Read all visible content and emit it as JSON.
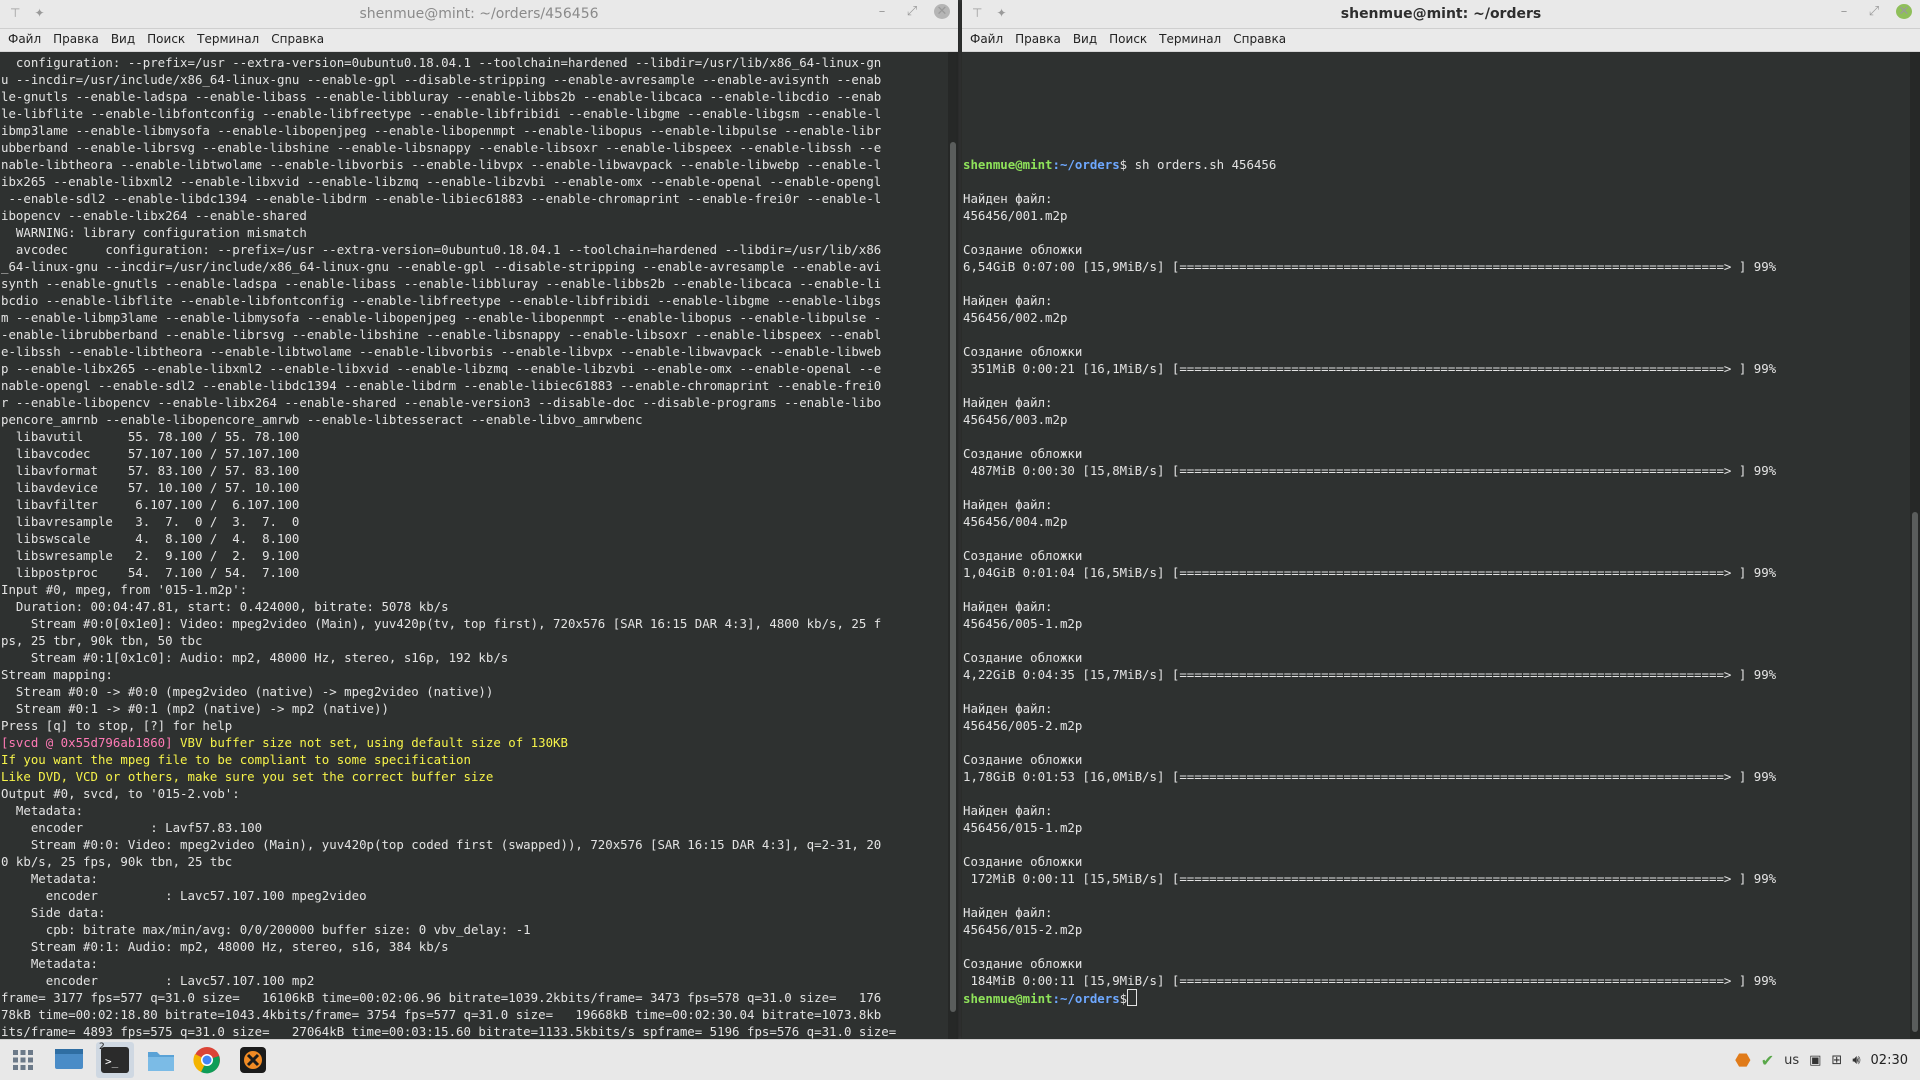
{
  "colors": {
    "accent_green": "#8fe35a",
    "path_blue": "#6ea8ff",
    "warning_yellow": "#f6f34a"
  },
  "left": {
    "title": "shenmue@mint: ~/orders/456456",
    "menu": [
      "Файл",
      "Правка",
      "Вид",
      "Поиск",
      "Терминал",
      "Справка"
    ],
    "lines": [
      {
        "t": "  configuration: --prefix=/usr --extra-version=0ubuntu0.18.04.1 --toolchain=hardened --libdir=/usr/lib/x86_64-linux-gn"
      },
      {
        "t": "u --incdir=/usr/include/x86_64-linux-gnu --enable-gpl --disable-stripping --enable-avresample --enable-avisynth --enab"
      },
      {
        "t": "le-gnutls --enable-ladspa --enable-libass --enable-libbluray --enable-libbs2b --enable-libcaca --enable-libcdio --enab"
      },
      {
        "t": "le-libflite --enable-libfontconfig --enable-libfreetype --enable-libfribidi --enable-libgme --enable-libgsm --enable-l"
      },
      {
        "t": "ibmp3lame --enable-libmysofa --enable-libopenjpeg --enable-libopenmpt --enable-libopus --enable-libpulse --enable-libr"
      },
      {
        "t": "ubberband --enable-librsvg --enable-libshine --enable-libsnappy --enable-libsoxr --enable-libspeex --enable-libssh --e"
      },
      {
        "t": "nable-libtheora --enable-libtwolame --enable-libvorbis --enable-libvpx --enable-libwavpack --enable-libwebp --enable-l"
      },
      {
        "t": "ibx265 --enable-libxml2 --enable-libxvid --enable-libzmq --enable-libzvbi --enable-omx --enable-openal --enable-opengl"
      },
      {
        "t": " --enable-sdl2 --enable-libdc1394 --enable-libdrm --enable-libiec61883 --enable-chromaprint --enable-frei0r --enable-l"
      },
      {
        "t": "ibopencv --enable-libx264 --enable-shared"
      },
      {
        "t": "  WARNING: library configuration mismatch"
      },
      {
        "t": "  avcodec     configuration: --prefix=/usr --extra-version=0ubuntu0.18.04.1 --toolchain=hardened --libdir=/usr/lib/x86"
      },
      {
        "t": "_64-linux-gnu --incdir=/usr/include/x86_64-linux-gnu --enable-gpl --disable-stripping --enable-avresample --enable-avi"
      },
      {
        "t": "synth --enable-gnutls --enable-ladspa --enable-libass --enable-libbluray --enable-libbs2b --enable-libcaca --enable-li"
      },
      {
        "t": "bcdio --enable-libflite --enable-libfontconfig --enable-libfreetype --enable-libfribidi --enable-libgme --enable-libgs"
      },
      {
        "t": "m --enable-libmp3lame --enable-libmysofa --enable-libopenjpeg --enable-libopenmpt --enable-libopus --enable-libpulse -"
      },
      {
        "t": "-enable-librubberband --enable-librsvg --enable-libshine --enable-libsnappy --enable-libsoxr --enable-libspeex --enabl"
      },
      {
        "t": "e-libssh --enable-libtheora --enable-libtwolame --enable-libvorbis --enable-libvpx --enable-libwavpack --enable-libweb"
      },
      {
        "t": "p --enable-libx265 --enable-libxml2 --enable-libxvid --enable-libzmq --enable-libzvbi --enable-omx --enable-openal --e"
      },
      {
        "t": "nable-opengl --enable-sdl2 --enable-libdc1394 --enable-libdrm --enable-libiec61883 --enable-chromaprint --enable-frei0"
      },
      {
        "t": "r --enable-libopencv --enable-libx264 --enable-shared --enable-version3 --disable-doc --disable-programs --enable-libo"
      },
      {
        "t": "pencore_amrnb --enable-libopencore_amrwb --enable-libtesseract --enable-libvo_amrwbenc"
      },
      {
        "t": "  libavutil      55. 78.100 / 55. 78.100"
      },
      {
        "t": "  libavcodec     57.107.100 / 57.107.100"
      },
      {
        "t": "  libavformat    57. 83.100 / 57. 83.100"
      },
      {
        "t": "  libavdevice    57. 10.100 / 57. 10.100"
      },
      {
        "t": "  libavfilter     6.107.100 /  6.107.100"
      },
      {
        "t": "  libavresample   3.  7.  0 /  3.  7.  0"
      },
      {
        "t": "  libswscale      4.  8.100 /  4.  8.100"
      },
      {
        "t": "  libswresample   2.  9.100 /  2.  9.100"
      },
      {
        "t": "  libpostproc    54.  7.100 / 54.  7.100"
      },
      {
        "t": "Input #0, mpeg, from '015-1.m2p':"
      },
      {
        "t": "  Duration: 00:04:47.81, start: 0.424000, bitrate: 5078 kb/s"
      },
      {
        "t": "    Stream #0:0[0x1e0]: Video: mpeg2video (Main), yuv420p(tv, top first), 720x576 [SAR 16:15 DAR 4:3], 4800 kb/s, 25 f"
      },
      {
        "t": "ps, 25 tbr, 90k tbn, 50 tbc"
      },
      {
        "t": "    Stream #0:1[0x1c0]: Audio: mp2, 48000 Hz, stereo, s16p, 192 kb/s"
      },
      {
        "t": "Stream mapping:"
      },
      {
        "t": "  Stream #0:0 -> #0:0 (mpeg2video (native) -> mpeg2video (native))"
      },
      {
        "t": "  Stream #0:1 -> #0:1 (mp2 (native) -> mp2 (native))"
      },
      {
        "t": "Press [q] to stop, [?] for help"
      },
      {
        "t": "[svcd @ 0x55d796ab1860] ",
        "cls": "pinkbg",
        "t2": "VBV buffer size not set, using default size of 130KB"
      },
      {
        "t": "If you want the mpeg file to be compliant to some specification",
        "cls": "yellow"
      },
      {
        "t": "Like DVD, VCD or others, make sure you set the correct buffer size",
        "cls": "yellow"
      },
      {
        "t": "Output #0, svcd, to '015-2.vob':"
      },
      {
        "t": "  Metadata:"
      },
      {
        "t": "    encoder         : Lavf57.83.100"
      },
      {
        "t": "    Stream #0:0: Video: mpeg2video (Main), yuv420p(top coded first (swapped)), 720x576 [SAR 16:15 DAR 4:3], q=2-31, 20"
      },
      {
        "t": "0 kb/s, 25 fps, 90k tbn, 25 tbc"
      },
      {
        "t": "    Metadata:"
      },
      {
        "t": "      encoder         : Lavc57.107.100 mpeg2video"
      },
      {
        "t": "    Side data:"
      },
      {
        "t": "      cpb: bitrate max/min/avg: 0/0/200000 buffer size: 0 vbv_delay: -1"
      },
      {
        "t": "    Stream #0:1: Audio: mp2, 48000 Hz, stereo, s16, 384 kb/s"
      },
      {
        "t": "    Metadata:"
      },
      {
        "t": "      encoder         : Lavc57.107.100 mp2"
      },
      {
        "t": "frame= 3177 fps=577 q=31.0 size=   16106kB time=00:02:06.96 bitrate=1039.2kbits/frame= 3473 fps=578 q=31.0 size=   176"
      },
      {
        "t": "78kB time=00:02:18.80 bitrate=1043.4kbits/frame= 3754 fps=577 q=31.0 size=   19668kB time=00:02:30.04 bitrate=1073.8kb"
      },
      {
        "t": "its/frame= 4893 fps=575 q=31.0 size=   27064kB time=00:03:15.60 bitrate=1133.5kbits/s spframe= 5196 fps=576 q=31.0 size="
      }
    ]
  },
  "right": {
    "title": "shenmue@mint: ~/orders",
    "menu": [
      "Файл",
      "Правка",
      "Вид",
      "Поиск",
      "Терминал",
      "Справка"
    ],
    "prompt_user": "shenmue@mint",
    "prompt_path": ":~/orders",
    "command": "$ sh orders.sh 456456",
    "found_label": "Найден файл:",
    "cover_label": "Создание обложки",
    "bar": "[=========================================================================> ] 99%",
    "entries": [
      {
        "file": "456456/001.m2p",
        "stats": "6,54GiB 0:07:00 [15,9MiB/s] "
      },
      {
        "file": "456456/002.m2p",
        "stats": " 351MiB 0:00:21 [16,1MiB/s] "
      },
      {
        "file": "456456/003.m2p",
        "stats": " 487MiB 0:00:30 [15,8MiB/s] "
      },
      {
        "file": "456456/004.m2p",
        "stats": "1,04GiB 0:01:04 [16,5MiB/s] "
      },
      {
        "file": "456456/005-1.m2p",
        "stats": "4,22GiB 0:04:35 [15,7MiB/s] "
      },
      {
        "file": "456456/005-2.m2p",
        "stats": "1,78GiB 0:01:53 [16,0MiB/s] "
      },
      {
        "file": "456456/015-1.m2p",
        "stats": " 172MiB 0:00:11 [15,5MiB/s] "
      },
      {
        "file": "456456/015-2.m2p",
        "stats": " 184MiB 0:00:11 [15,9MiB/s] "
      }
    ],
    "final_prompt_symbol": "$"
  },
  "taskbar": {
    "apps": [
      "menu-grid-icon",
      "show-desktop-icon",
      "terminal-icon",
      "files-icon",
      "chrome-icon",
      "vlc-like-icon"
    ],
    "terminal_badge": "2",
    "keyboard_layout": "us",
    "clock": "02:30"
  }
}
